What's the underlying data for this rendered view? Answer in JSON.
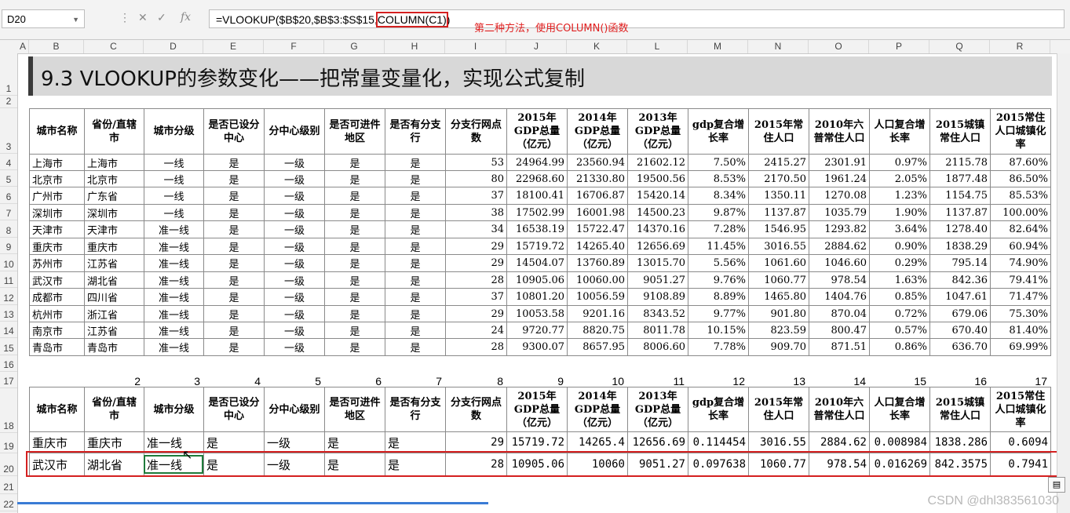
{
  "formula_bar": {
    "name_box": "D20",
    "formula_pre": "=VLOOKUP($B$20,$B$3:$S$15,",
    "formula_hl": "COLUMN(C1)",
    "formula_post": ")"
  },
  "annotation": "第二种方法，使用COLUMN()函数",
  "columns": [
    "A",
    "B",
    "C",
    "D",
    "E",
    "F",
    "G",
    "H",
    "I",
    "J",
    "K",
    "L",
    "M",
    "N",
    "O",
    "P",
    "Q",
    "R"
  ],
  "rows": [
    "1",
    "2",
    "3",
    "4",
    "5",
    "6",
    "7",
    "8",
    "9",
    "10",
    "11",
    "12",
    "13",
    "14",
    "15",
    "16",
    "17",
    "18",
    "19",
    "20",
    "21",
    "22"
  ],
  "title": "9.3 VLOOKUP的参数变化——把常量变量化，实现公式复制",
  "headers": [
    "城市名称",
    "省份/直辖市",
    "城市分级",
    "是否已设分中心",
    "分中心级别",
    "是否可进件地区",
    "是否有分支行",
    "分支行网点数",
    "2015年GDP总量（亿元）",
    "2014年GDP总量（亿元）",
    "2013年GDP总量（亿元）",
    "gdp复合增长率",
    "2015年常住人口",
    "2010年六普常住人口",
    "人口复合增长率",
    "2015城镇常住人口",
    "2015常住人口城镇化率"
  ],
  "table1": [
    [
      "上海市",
      "上海市",
      "一线",
      "是",
      "一级",
      "是",
      "是",
      "53",
      "24964.99",
      "23560.94",
      "21602.12",
      "7.50%",
      "2415.27",
      "2301.91",
      "0.97%",
      "2115.78",
      "87.60%"
    ],
    [
      "北京市",
      "北京市",
      "一线",
      "是",
      "一级",
      "是",
      "是",
      "80",
      "22968.60",
      "21330.80",
      "19500.56",
      "8.53%",
      "2170.50",
      "1961.24",
      "2.05%",
      "1877.48",
      "86.50%"
    ],
    [
      "广州市",
      "广东省",
      "一线",
      "是",
      "一级",
      "是",
      "是",
      "37",
      "18100.41",
      "16706.87",
      "15420.14",
      "8.34%",
      "1350.11",
      "1270.08",
      "1.23%",
      "1154.75",
      "85.53%"
    ],
    [
      "深圳市",
      "深圳市",
      "一线",
      "是",
      "一级",
      "是",
      "是",
      "38",
      "17502.99",
      "16001.98",
      "14500.23",
      "9.87%",
      "1137.87",
      "1035.79",
      "1.90%",
      "1137.87",
      "100.00%"
    ],
    [
      "天津市",
      "天津市",
      "准一线",
      "是",
      "一级",
      "是",
      "是",
      "34",
      "16538.19",
      "15722.47",
      "14370.16",
      "7.28%",
      "1546.95",
      "1293.82",
      "3.64%",
      "1278.40",
      "82.64%"
    ],
    [
      "重庆市",
      "重庆市",
      "准一线",
      "是",
      "一级",
      "是",
      "是",
      "29",
      "15719.72",
      "14265.40",
      "12656.69",
      "11.45%",
      "3016.55",
      "2884.62",
      "0.90%",
      "1838.29",
      "60.94%"
    ],
    [
      "苏州市",
      "江苏省",
      "准一线",
      "是",
      "一级",
      "是",
      "是",
      "29",
      "14504.07",
      "13760.89",
      "13015.70",
      "5.56%",
      "1061.60",
      "1046.60",
      "0.29%",
      "795.14",
      "74.90%"
    ],
    [
      "武汉市",
      "湖北省",
      "准一线",
      "是",
      "一级",
      "是",
      "是",
      "28",
      "10905.06",
      "10060.00",
      "9051.27",
      "9.76%",
      "1060.77",
      "978.54",
      "1.63%",
      "842.36",
      "79.41%"
    ],
    [
      "成都市",
      "四川省",
      "准一线",
      "是",
      "一级",
      "是",
      "是",
      "37",
      "10801.20",
      "10056.59",
      "9108.89",
      "8.89%",
      "1465.80",
      "1404.76",
      "0.85%",
      "1047.61",
      "71.47%"
    ],
    [
      "杭州市",
      "浙江省",
      "准一线",
      "是",
      "一级",
      "是",
      "是",
      "29",
      "10053.58",
      "9201.16",
      "8343.52",
      "9.77%",
      "901.80",
      "870.04",
      "0.72%",
      "679.06",
      "75.30%"
    ],
    [
      "南京市",
      "江苏省",
      "准一线",
      "是",
      "一级",
      "是",
      "是",
      "24",
      "9720.77",
      "8820.75",
      "8011.78",
      "10.15%",
      "823.59",
      "800.47",
      "0.57%",
      "670.40",
      "81.40%"
    ],
    [
      "青岛市",
      "青岛市",
      "准一线",
      "是",
      "一级",
      "是",
      "是",
      "28",
      "9300.07",
      "8657.95",
      "8006.60",
      "7.78%",
      "909.70",
      "871.51",
      "0.86%",
      "636.70",
      "69.99%"
    ]
  ],
  "index_numbers": [
    "2",
    "3",
    "4",
    "5",
    "6",
    "7",
    "8",
    "9",
    "10",
    "11",
    "12",
    "13",
    "14",
    "15",
    "16",
    "17"
  ],
  "table2": [
    [
      "重庆市",
      "重庆市",
      "准一线",
      "是",
      "一级",
      "是",
      "是",
      "29",
      "15719.72",
      "14265.4",
      "12656.69",
      "0.114454",
      "3016.55",
      "2884.62",
      "0.008984",
      "1838.286",
      "0.6094"
    ],
    [
      "武汉市",
      "湖北省",
      "准一线",
      "是",
      "一级",
      "是",
      "是",
      "28",
      "10905.06",
      "10060",
      "9051.27",
      "0.097638",
      "1060.77",
      "978.54",
      "0.016269",
      "842.3575",
      "0.7941"
    ]
  ],
  "watermark": "CSDN @dhl383561030",
  "colors": {
    "highlight_border": "#d42020",
    "selection_border": "#1e7b3a",
    "title_bg": "#d8d8d8"
  }
}
